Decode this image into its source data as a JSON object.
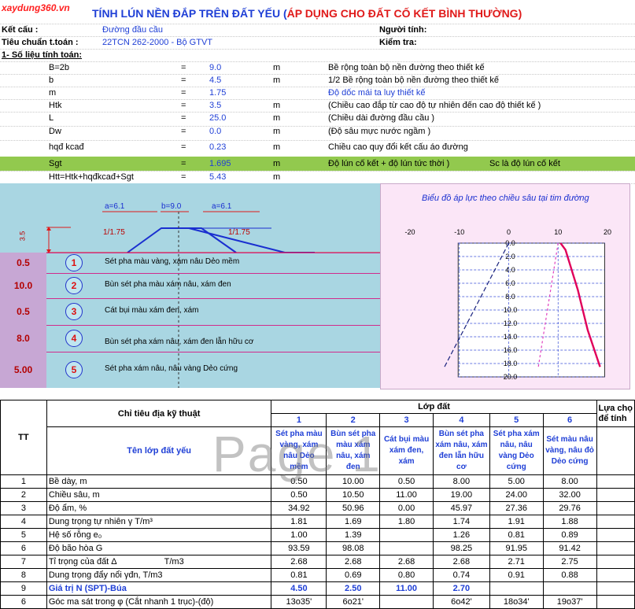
{
  "logo": "xaydung360.vn",
  "title_main": "TÍNH LÚN NỀN ĐẮP TRÊN ĐẤT YẾU (",
  "title_red": "ÁP DỤNG CHO ĐẤT CỐ KẾT BÌNH THƯỜNG)",
  "header": {
    "ket_cau_label": "Kết cấu :",
    "ket_cau_value": "Đường đầu cầu",
    "nguoi_tinh_label": "Người tính:",
    "tieu_chuan_label": "Tiêu chuẩn t.toán :",
    "tieu_chuan_value": "22TCN 262-2000  - Bộ GTVT",
    "kiem_tra_label": "Kiểm tra:",
    "section": "1- Số liệu tính toán:"
  },
  "params": [
    {
      "name": "B=2b",
      "eq": "=",
      "value": "9.0",
      "unit": "m",
      "desc": "Bề rộng toàn bộ nền đường theo thiết kế",
      "desc_blue": false
    },
    {
      "name": "b",
      "eq": "=",
      "value": "4.5",
      "unit": "m",
      "desc": "1/2 Bề rộng toàn bộ nền đường theo thiết kế",
      "desc_blue": false
    },
    {
      "name": "m",
      "eq": "=",
      "value": "1.75",
      "unit": "",
      "desc": "Độ dốc mái ta luy thiết kế",
      "desc_blue": true
    },
    {
      "name": "Htk",
      "eq": "=",
      "value": "3.5",
      "unit": "m",
      "desc": "(Chiều cao đắp từ cao độ tự nhiên đến cao độ thiết kế )",
      "desc_blue": false
    },
    {
      "name": "L",
      "eq": "=",
      "value": "25.0",
      "unit": "m",
      "desc": "(Chiều dài đường đầu cầu )",
      "desc_blue": false
    },
    {
      "name": "Dw",
      "eq": "=",
      "value": "0.0",
      "unit": "m",
      "desc": "(Độ sâu mực nước ngầm )",
      "desc_blue": false
    },
    {
      "name": "hqđ kcađ",
      "eq": "=",
      "value": "0.23",
      "unit": "m",
      "desc": "Chiều cao quy đổi kết cấu áo đường",
      "desc_blue": false
    },
    {
      "name": "Sgt",
      "eq": "=",
      "value": "1.695",
      "unit": "m",
      "desc": "Độ lún cố kết + độ lún tức thời )",
      "desc_blue": false,
      "extra": "Sc là độ lún cố kết"
    },
    {
      "name": "Htt=Htk+hqđkcađ+Sgt",
      "eq": "=",
      "value": "5.43",
      "unit": "m",
      "desc": "",
      "desc_blue": false
    }
  ],
  "diagram": {
    "a_left": "a=6.1",
    "b_mid": "b=9.0",
    "a_right": "a=6.1",
    "slope_left": "1/1.75",
    "slope_right": "1/1.75",
    "height": "3.5",
    "layers": [
      {
        "depth": "0.5",
        "num": "1",
        "desc": "Sét pha màu vàng, xám nâu   Dẻo mềm"
      },
      {
        "depth": "10.0",
        "num": "2",
        "desc": "Bùn sét pha màu xám nâu, xám đen"
      },
      {
        "depth": "0.5",
        "num": "3",
        "desc": "Cát bụi màu xám đen, xám"
      },
      {
        "depth": "8.0",
        "num": "4",
        "desc": "Bùn sét pha xám nâu, xám đen lẫn hữu cơ"
      },
      {
        "depth": "5.00",
        "num": "5",
        "desc": "Sét pha xám nâu, nâu vàng   Dẻo cứng"
      }
    ]
  },
  "chart_data": {
    "type": "line",
    "title": "Biểu đồ áp lực theo chiều sâu tại tim đường",
    "x_ticks": [
      "-20",
      "-10",
      "0",
      "10",
      "20"
    ],
    "y_ticks": [
      "0.0",
      "2.0",
      "4.0",
      "6.0",
      "8.0",
      "10.0",
      "12.0",
      "14.0",
      "16.0",
      "18.0",
      "20.0"
    ],
    "xlim": [
      -20,
      20
    ],
    "ylim": [
      0,
      20
    ],
    "y_inverted": true,
    "series": [
      {
        "values_x": [
          0,
          -13
        ],
        "values_y": [
          0,
          18.5
        ],
        "color": "#1a237e",
        "dash": "6,3"
      },
      {
        "values_x": [
          10,
          6
        ],
        "values_y": [
          0,
          18.5
        ],
        "color": "#e040c0",
        "dash": "3,3"
      },
      {
        "values_x": [
          10.5,
          11.5,
          14,
          16,
          18.5
        ],
        "values_y": [
          0,
          1,
          7,
          13,
          18.5
        ],
        "color": "#e0005a",
        "dash": ""
      }
    ]
  },
  "table": {
    "h_tt": "TT",
    "h_chi_tieu": "Chỉ tiêu địa kỹ thuật",
    "h_lop_dat": "Lớp đất",
    "h_lua_chon": "Lựa chọ",
    "h_de_tinh": "để tính",
    "cols": [
      "1",
      "2",
      "3",
      "4",
      "5",
      "6"
    ],
    "h_ten_lop": "Tên lớp đất yếu",
    "names": [
      "Sét pha màu vàng, xám nâu Dẻo mềm",
      "Bùn sét pha màu xám nâu, xám đen",
      "Cát bụi màu xám đen, xám",
      "Bùn sét pha xám nâu, xám đen lẫn hữu cơ",
      "Sét pha xám nâu, nâu vàng  Dẻo cứng",
      "Sét màu nâu vàng, nâu đỏ Dẻo cứng"
    ],
    "rows": [
      {
        "tt": "1",
        "label": "Bề dày, m",
        "extra": "",
        "vals": [
          "0.50",
          "10.00",
          "0.50",
          "8.00",
          "5.00",
          "8.00"
        ],
        "blue": false
      },
      {
        "tt": "2",
        "label": "Chiều sâu, m",
        "extra": "",
        "vals": [
          "0.50",
          "10.50",
          "11.00",
          "19.00",
          "24.00",
          "32.00"
        ],
        "blue": false
      },
      {
        "tt": "3",
        "label": "Độ ẩm, %",
        "extra": "",
        "vals": [
          "34.92",
          "50.96",
          "0.00",
          "45.97",
          "27.36",
          "29.76"
        ],
        "blue": false
      },
      {
        "tt": "4",
        "label": "Dung trọng tự nhiên γ T/m³",
        "extra": "",
        "vals": [
          "1.81",
          "1.69",
          "1.80",
          "1.74",
          "1.91",
          "1.88"
        ],
        "blue": false
      },
      {
        "tt": "5",
        "label": "Hệ số rỗng e₀",
        "extra": "",
        "vals": [
          "1.00",
          "1.39",
          "",
          "1.26",
          "0.81",
          "0.89"
        ],
        "blue": false
      },
      {
        "tt": "6",
        "label": "Độ bão hòa G",
        "extra": "",
        "vals": [
          "93.59",
          "98.08",
          "",
          "98.25",
          "91.95",
          "91.42"
        ],
        "blue": false
      },
      {
        "tt": "7",
        "label": "Tỉ trọng của đất Δ",
        "extra": "T/m3",
        "vals": [
          "2.68",
          "2.68",
          "2.68",
          "2.68",
          "2.71",
          "2.75"
        ],
        "blue": false
      },
      {
        "tt": "8",
        "label": "Dung trọng đẩy nổi γđn, T/m3",
        "extra": "",
        "vals": [
          "0.81",
          "0.69",
          "0.80",
          "0.74",
          "0.91",
          "0.88"
        ],
        "blue": false
      },
      {
        "tt": "9",
        "label": "Giá trị N (SPT)-Búa",
        "extra": "",
        "vals": [
          "4.50",
          "2.50",
          "11.00",
          "2.70",
          "",
          ""
        ],
        "blue": true
      },
      {
        "tt": "6",
        "label": "Góc ma sát trong φ  (Cắt nhanh 1 trục)-(độ)",
        "extra": "",
        "vals": [
          "13o35'",
          "6o21'",
          "",
          "6o42'",
          "18o34'",
          "19o37'"
        ],
        "blue": false
      }
    ]
  },
  "watermark": "Page 1"
}
